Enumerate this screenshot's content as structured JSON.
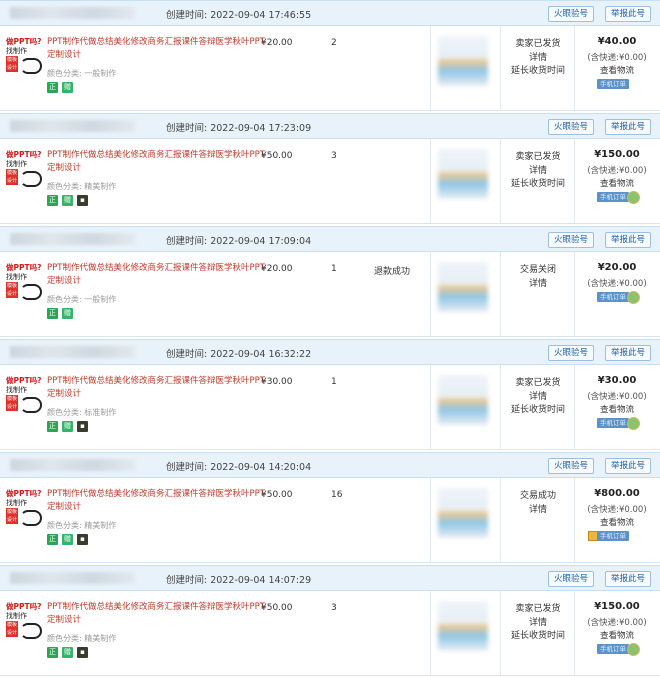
{
  "labels": {
    "created_prefix": "创建时间:",
    "verify_btn": "火眼验号",
    "report_btn": "举报此号",
    "product_title": "PPT制作代做总结美化修改商务汇报课件答辩医学秋叶PPT定制设计",
    "spec_prefix": "颜色分类:",
    "detail": "详情",
    "extend": "延长收货时间",
    "view_logistics": "查看物流",
    "handheld_order": "手机订单",
    "fee_text": "(含快递:¥0.00)",
    "thumb_line1": "做PPT吗?",
    "thumb_line2": "找制作",
    "thumb_badge": "模板设计",
    "tag_zheng": "正",
    "tag_gift": "赠",
    "tag_pkg": "▪"
  },
  "orders": [
    {
      "created": "2022-09-04 17:46:55",
      "spec": "一般制作",
      "price": "¥20.00",
      "qty": "2",
      "refund": "",
      "status": "卖家已发货",
      "total": "¥40.00",
      "show_extend": true,
      "show_logistics": true,
      "tags": [
        "正",
        "赠"
      ]
    },
    {
      "created": "2022-09-04 17:23:09",
      "spec": "精美制作",
      "price": "¥50.00",
      "qty": "3",
      "refund": "",
      "status": "卖家已发货",
      "total": "¥150.00",
      "show_extend": true,
      "show_logistics": true,
      "tags": [
        "正",
        "赠",
        "包"
      ]
    },
    {
      "created": "2022-09-04 17:09:04",
      "spec": "一般制作",
      "price": "¥20.00",
      "qty": "1",
      "refund": "退款成功",
      "status": "交易关闭",
      "total": "¥20.00",
      "show_extend": false,
      "show_logistics": false,
      "tags": [
        "正",
        "赠"
      ]
    },
    {
      "created": "2022-09-04 16:32:22",
      "spec": "标准制作",
      "price": "¥30.00",
      "qty": "1",
      "refund": "",
      "status": "卖家已发货",
      "total": "¥30.00",
      "show_extend": true,
      "show_logistics": true,
      "tags": [
        "正",
        "赠",
        "包"
      ]
    },
    {
      "created": "2022-09-04 14:20:04",
      "spec": "精美制作",
      "price": "¥50.00",
      "qty": "16",
      "refund": "",
      "status": "交易成功",
      "total": "¥800.00",
      "show_extend": false,
      "show_logistics": true,
      "tags": [
        "正",
        "赠",
        "包"
      ]
    },
    {
      "created": "2022-09-04 14:07:29",
      "spec": "精美制作",
      "price": "¥50.00",
      "qty": "3",
      "refund": "",
      "status": "卖家已发货",
      "total": "¥150.00",
      "show_extend": true,
      "show_logistics": true,
      "tags": [
        "正",
        "赠",
        "包"
      ]
    }
  ]
}
